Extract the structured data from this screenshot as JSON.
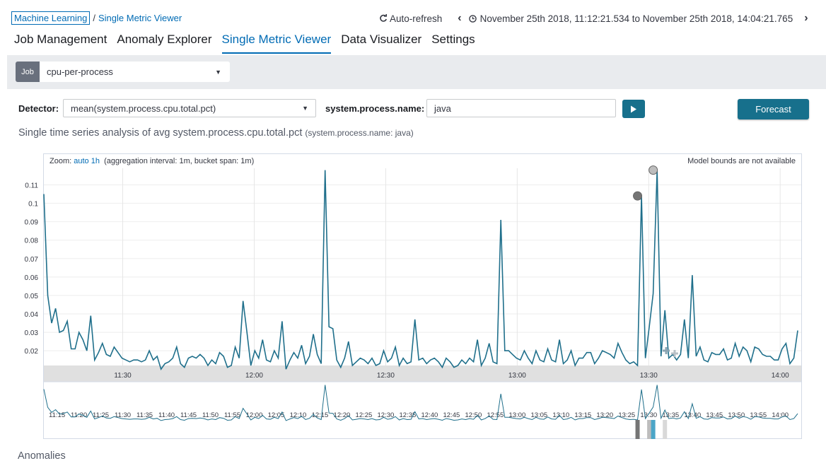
{
  "breadcrumb": {
    "root": "Machine Learning",
    "separator": "/",
    "current": "Single Metric Viewer"
  },
  "header": {
    "auto_refresh": "Auto-refresh",
    "time_range": "November 25th 2018, 11:12:21.534 to November 25th 2018, 14:04:21.765"
  },
  "tabs": [
    "Job Management",
    "Anomaly Explorer",
    "Single Metric Viewer",
    "Data Visualizer",
    "Settings"
  ],
  "active_tab": "Single Metric Viewer",
  "job": {
    "label": "Job",
    "value": "cpu-per-process"
  },
  "detector": {
    "label": "Detector:",
    "value": "mean(system.process.cpu.total.pct)"
  },
  "entity": {
    "label": "system.process.name:",
    "value": "java"
  },
  "forecast_label": "Forecast",
  "subtitle": {
    "main": "Single time series analysis of avg system.process.cpu.total.pct",
    "suffix": "(system.process.name: java)"
  },
  "chart_header": {
    "zoom_label": "Zoom:",
    "zoom_value": "auto 1h",
    "interval": "(aggregation interval: 1m, bucket span: 1m)",
    "bounds_note": "Model bounds are not available"
  },
  "anomalies_title": "Anomalies",
  "colors": {
    "accent": "#006bb4",
    "line": "#1f6f8b",
    "button": "#17708c"
  },
  "chart_data": {
    "type": "line",
    "series": [
      {
        "values": [
          0.105,
          0.05,
          0.035,
          0.043,
          0.03,
          0.031,
          0.036,
          0.021,
          0.021,
          0.03,
          0.026,
          0.02,
          0.039,
          0.015,
          0.019,
          0.024,
          0.018,
          0.017,
          0.022,
          0.019,
          0.016,
          0.015,
          0.014,
          0.015,
          0.015,
          0.014,
          0.015,
          0.02,
          0.015,
          0.017,
          0.01,
          0.013,
          0.014,
          0.016,
          0.022,
          0.013,
          0.011,
          0.016,
          0.017,
          0.016,
          0.018,
          0.016,
          0.012,
          0.015,
          0.013,
          0.019,
          0.017,
          0.011,
          0.012,
          0.022,
          0.016,
          0.047,
          0.03,
          0.012,
          0.02,
          0.016,
          0.026,
          0.015,
          0.014,
          0.02,
          0.016,
          0.036,
          0.01,
          0.015,
          0.019,
          0.016,
          0.023,
          0.013,
          0.017,
          0.029,
          0.018,
          0.013,
          0.118,
          0.033,
          0.032,
          0.015,
          0.011,
          0.016,
          0.025,
          0.012,
          0.014,
          0.016,
          0.015,
          0.013,
          0.016,
          0.012,
          0.013,
          0.02,
          0.014,
          0.016,
          0.022,
          0.012,
          0.016,
          0.013,
          0.014,
          0.037,
          0.015,
          0.016,
          0.013,
          0.015,
          0.016,
          0.014,
          0.011,
          0.016,
          0.014,
          0.011,
          0.012,
          0.015,
          0.013,
          0.016,
          0.014,
          0.026,
          0.012,
          0.016,
          0.024,
          0.014,
          0.013,
          0.091,
          0.02,
          0.02,
          0.018,
          0.016,
          0.015,
          0.02,
          0.016,
          0.013,
          0.02,
          0.015,
          0.014,
          0.021,
          0.015,
          0.014,
          0.026,
          0.013,
          0.015,
          0.02,
          0.012,
          0.016,
          0.016,
          0.019,
          0.019,
          0.013,
          0.016,
          0.02,
          0.019,
          0.018,
          0.016,
          0.024,
          0.019,
          0.015,
          0.013,
          0.014,
          0.012,
          0.104,
          0.016,
          0.033,
          0.051,
          0.118,
          0.017,
          0.042,
          0.016,
          0.018,
          0.015,
          0.018,
          0.037,
          0.016,
          0.061,
          0.017,
          0.022,
          0.015,
          0.014,
          0.019,
          0.018,
          0.018,
          0.021,
          0.015,
          0.016,
          0.024,
          0.017,
          0.022,
          0.02,
          0.014,
          0.022,
          0.021,
          0.018,
          0.017,
          0.017,
          0.015,
          0.015,
          0.021,
          0.024,
          0.013,
          0.016,
          0.031
        ]
      }
    ],
    "x_start": "11:12",
    "x_end": "14:04",
    "x_ticks": [
      "11:30",
      "12:00",
      "12:30",
      "13:00",
      "13:30",
      "14:00"
    ],
    "y_ticks": [
      "0.02",
      "0.03",
      "0.04",
      "0.05",
      "0.06",
      "0.07",
      "0.08",
      "0.09",
      "0.1",
      "0.11"
    ],
    "ylim": [
      0.012,
      0.119
    ],
    "context_ticks": [
      "11:15",
      "11:20",
      "11:25",
      "11:30",
      "11:35",
      "11:40",
      "11:45",
      "11:50",
      "11:55",
      "12:00",
      "12:05",
      "12:10",
      "12:15",
      "12:20",
      "12:25",
      "12:30",
      "12:35",
      "12:40",
      "12:45",
      "12:50",
      "12:55",
      "13:00",
      "13:05",
      "13:10",
      "13:15",
      "13:20",
      "13:25",
      "13:30",
      "13:35",
      "13:40",
      "13:45",
      "13:50",
      "13:55",
      "14:00"
    ],
    "anomalies": [
      {
        "index": 152,
        "value": 0.104,
        "color": "#757575"
      },
      {
        "index": 156,
        "value": 0.118,
        "color": "#bdbdbd"
      }
    ],
    "swimlane_markers": [
      {
        "index": 152,
        "color": "#757575"
      },
      {
        "index": 155,
        "color": "#bdbdbd"
      },
      {
        "index": 156,
        "color": "#4ba5c7"
      },
      {
        "index": 159,
        "color": "#d9d9d9"
      }
    ]
  }
}
